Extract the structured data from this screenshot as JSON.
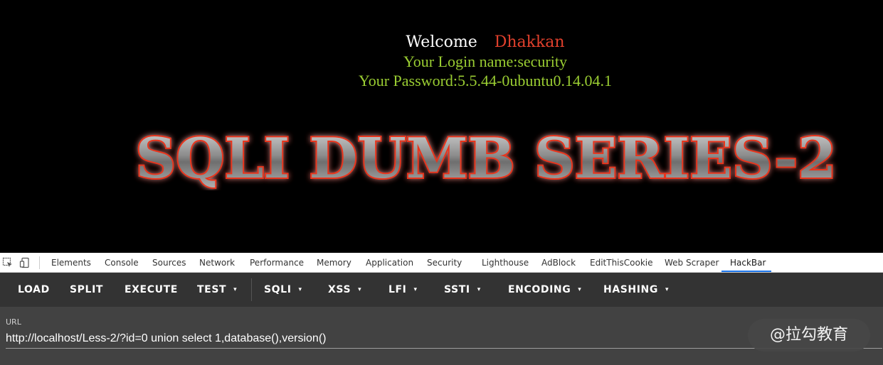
{
  "page": {
    "welcome_word": "Welcome",
    "welcome_name": "Dhakkan",
    "login_line": "Your Login name:security",
    "password_line": "Your Password:5.5.44-0ubuntu0.14.04.1",
    "logo_text": "SQLI DUMB SERIES-2"
  },
  "devtools": {
    "tabs": [
      {
        "label": "Elements"
      },
      {
        "label": "Console"
      },
      {
        "label": "Sources"
      },
      {
        "label": "Network"
      },
      {
        "label": "Performance"
      },
      {
        "label": "Memory"
      },
      {
        "label": "Application"
      },
      {
        "label": "Security"
      },
      {
        "label": "Lighthouse"
      },
      {
        "label": "AdBlock"
      },
      {
        "label": "EditThisCookie"
      },
      {
        "label": "Web Scraper"
      },
      {
        "label": "HackBar"
      }
    ],
    "active_tab": "HackBar",
    "icons": [
      "inspect-element-icon",
      "device-toolbar-icon"
    ]
  },
  "hackbar": {
    "buttons": [
      {
        "label": "LOAD"
      },
      {
        "label": "SPLIT"
      },
      {
        "label": "EXECUTE"
      },
      {
        "label": "TEST"
      },
      {
        "label": "SQLI"
      },
      {
        "label": "XSS"
      },
      {
        "label": "LFI"
      },
      {
        "label": "SSTI"
      },
      {
        "label": "ENCODING"
      },
      {
        "label": "HASHING"
      }
    ],
    "caret": "▾",
    "url_label": "URL",
    "url_value": "http://localhost/Less-2/?id=0 union select 1,database(),version()"
  },
  "watermark": {
    "text": "@拉勾教育"
  },
  "colors": {
    "welcome_name": "#e0402c",
    "login_text": "#9acd32",
    "hackbar_bg": "#333333",
    "url_bg": "#424242",
    "active_tab_underline": "#1a73e8"
  }
}
